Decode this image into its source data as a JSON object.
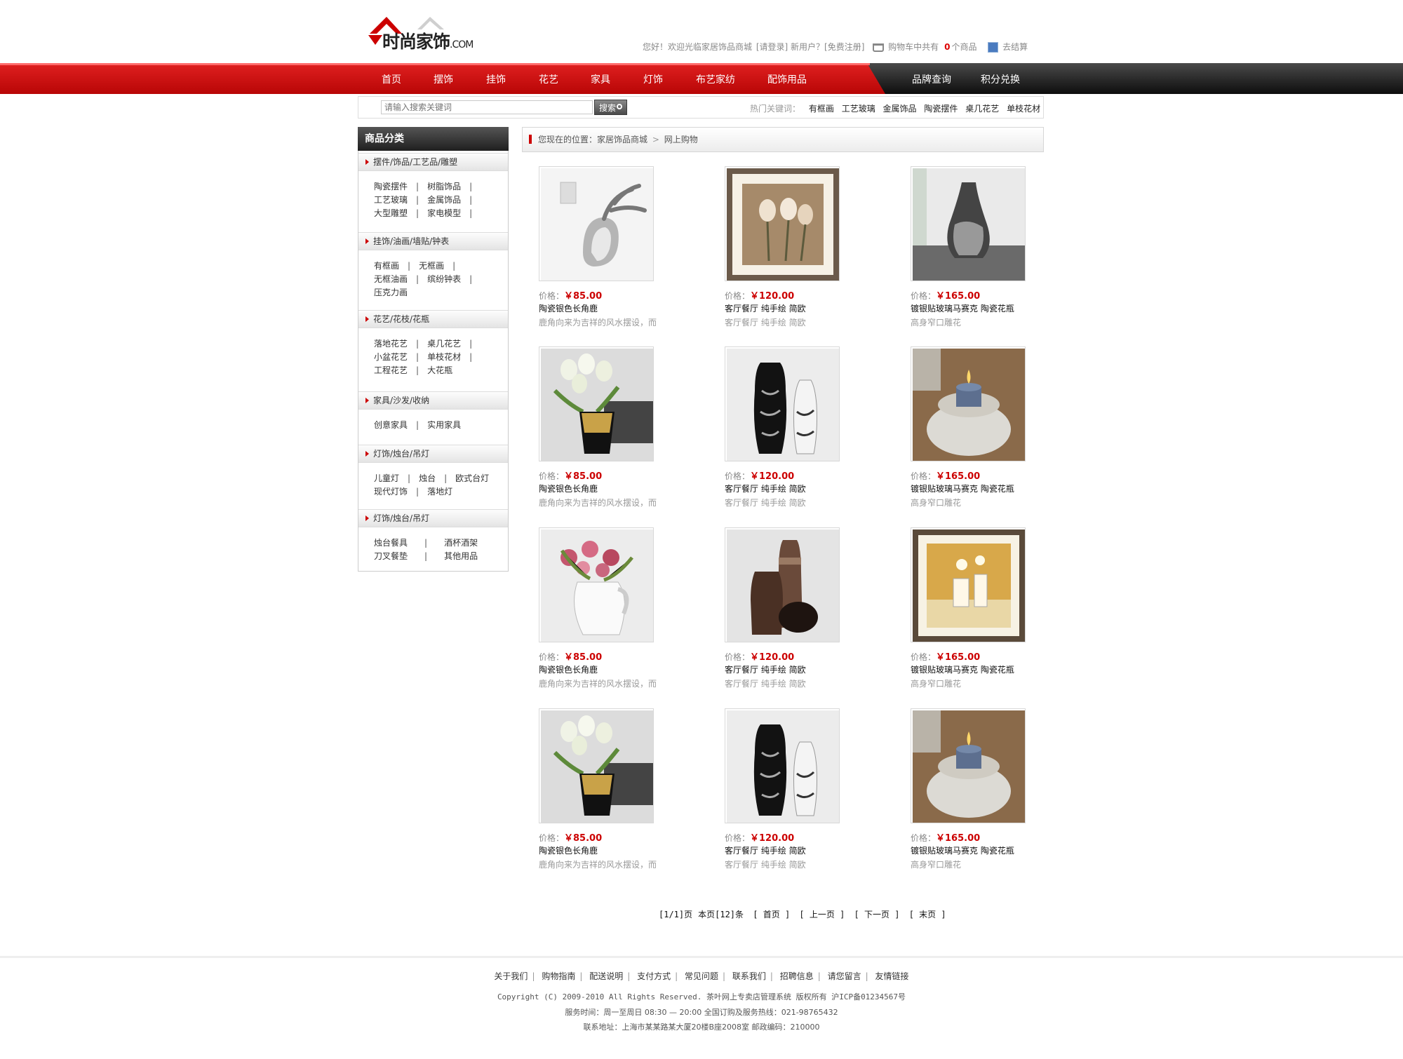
{
  "header": {
    "logo_text": "时尚家饰",
    "logo_suffix": ".COM",
    "greeting": "您好！欢迎光临家居饰品商城",
    "login": "[请登录]",
    "new_user": "新用户？[免费注册]",
    "cart_prefix": "购物车中共有",
    "cart_count": "0",
    "cart_suffix": "个商品",
    "checkout": "去结算",
    "accent_color": "#c00000"
  },
  "nav": {
    "items": [
      "首页",
      "摆饰",
      "挂饰",
      "花艺",
      "家具",
      "灯饰",
      "布艺家纺",
      "配饰用品"
    ],
    "right_items": [
      "品牌查询",
      "积分兑换"
    ]
  },
  "search": {
    "placeholder": "请输入搜索关键词",
    "button": "搜索",
    "hot_label": "热门关键词：",
    "hot_keywords": [
      "有框画",
      "工艺玻璃",
      "金属饰品",
      "陶瓷摆件",
      "桌几花艺",
      "单枝花材"
    ]
  },
  "sidebar": {
    "title": "商品分类",
    "categories": [
      {
        "title": "摆件/饰品/工艺品/雕塑",
        "rows": [
          [
            "陶瓷摆件",
            "树脂饰品"
          ],
          [
            "工艺玻璃",
            "金属饰品"
          ],
          [
            "大型雕塑",
            "家电模型"
          ]
        ]
      },
      {
        "title": "挂饰/油画/墙贴/钟表",
        "rows": [
          [
            "有框画",
            "无框画"
          ],
          [
            "无框油画",
            "缤纷钟表"
          ],
          [
            "压克力画"
          ]
        ]
      },
      {
        "title": "花艺/花枝/花瓶",
        "rows": [
          [
            "落地花艺",
            "桌几花艺"
          ],
          [
            "小盆花艺",
            "单枝花材"
          ],
          [
            "工程花艺",
            "大花瓶"
          ]
        ]
      },
      {
        "title": "家具/沙发/收纳",
        "rows": [
          [
            "创意家具",
            "实用家具"
          ]
        ]
      },
      {
        "title": "灯饰/烛台/吊灯",
        "rows": [
          [
            "儿童灯",
            "烛台",
            "欧式台灯"
          ],
          [
            "现代灯饰",
            "落地灯"
          ]
        ]
      },
      {
        "title": "灯饰/烛台/吊灯",
        "rows": [
          [
            "烛台餐具",
            "酒杯酒架"
          ],
          [
            "刀叉餐垫",
            "其他用品"
          ]
        ]
      }
    ]
  },
  "breadcrumb": {
    "prefix": "您现在的位置：",
    "home": "家居饰品商城",
    "sep": ">",
    "current": "网上购物"
  },
  "products": {
    "price_label": "价格：",
    "items": [
      {
        "price": "￥85.00",
        "name": "陶瓷银色长角鹿",
        "desc": "鹿角向来为吉祥的风水摆设，而",
        "img": "deer"
      },
      {
        "price": "￥120.00",
        "name": "客厅餐厅 纯手绘 简欧",
        "desc": "客厅餐厅 纯手绘 简欧",
        "img": "painting-tulip"
      },
      {
        "price": "￥165.00",
        "name": "镀银贴玻璃马赛克 陶瓷花瓶",
        "desc": "高身窄口雕花",
        "img": "vase-silver"
      },
      {
        "price": "￥85.00",
        "name": "陶瓷银色长角鹿",
        "desc": "鹿角向来为吉祥的风水摆设，而",
        "img": "tulips-gold"
      },
      {
        "price": "￥120.00",
        "name": "客厅餐厅 纯手绘 简欧",
        "desc": "客厅餐厅 纯手绘 简欧",
        "img": "vases-bw"
      },
      {
        "price": "￥165.00",
        "name": "镀银贴玻璃马赛克 陶瓷花瓶",
        "desc": "高身窄口雕花",
        "img": "candle"
      },
      {
        "price": "￥85.00",
        "name": "陶瓷银色长角鹿",
        "desc": "鹿角向来为吉祥的风水摆设，而",
        "img": "roses-jug"
      },
      {
        "price": "￥120.00",
        "name": "客厅餐厅 纯手绘 简欧",
        "desc": "客厅餐厅 纯手绘 简欧",
        "img": "vases-brown"
      },
      {
        "price": "￥165.00",
        "name": "镀银贴玻璃马赛克 陶瓷花瓶",
        "desc": "高身窄口雕花",
        "img": "painting-yellow"
      },
      {
        "price": "￥85.00",
        "name": "陶瓷银色长角鹿",
        "desc": "鹿角向来为吉祥的风水摆设，而",
        "img": "tulips-gold"
      },
      {
        "price": "￥120.00",
        "name": "客厅餐厅 纯手绘 简欧",
        "desc": "客厅餐厅 纯手绘 简欧",
        "img": "vases-bw"
      },
      {
        "price": "￥165.00",
        "name": "镀银贴玻璃马赛克 陶瓷花瓶",
        "desc": "高身窄口雕花",
        "img": "candle"
      }
    ]
  },
  "pager": {
    "info": "[1/1]页",
    "count": "本页[12]条",
    "first": "[ 首页 ]",
    "prev": "[ 上一页 ]",
    "next": "[ 下一页 ]",
    "last": "[ 末页 ]"
  },
  "footer": {
    "links": [
      "关于我们",
      "购物指南",
      "配送说明",
      "支付方式",
      "常见问题",
      "联系我们",
      "招聘信息",
      "请您留言",
      "友情链接"
    ],
    "copyright": "Copyright (C) 2009-2010 All Rights Reserved. 茶叶网上专卖店管理系统 版权所有   沪ICP备01234567号",
    "hours": "服务时间：周一至周日 08:30 — 20:00  全国订购及服务热线：021-98765432",
    "address": "联系地址：上海市某某路某大厦20楼B座2008室   邮政编码：210000"
  }
}
